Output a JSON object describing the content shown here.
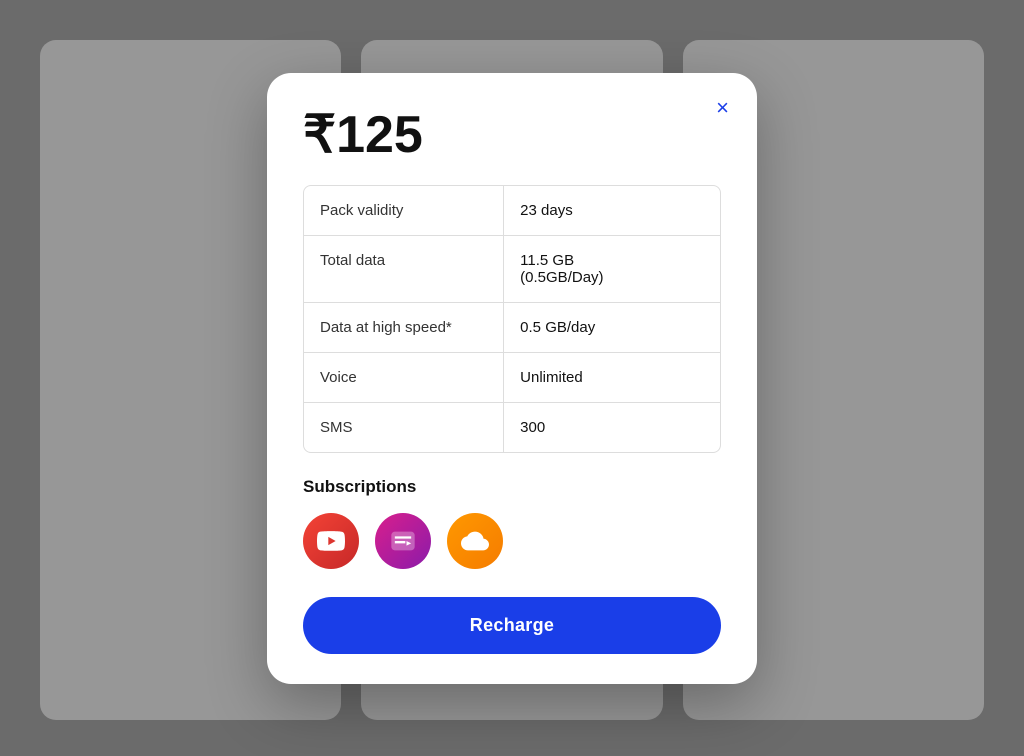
{
  "modal": {
    "price": "₹125",
    "close_label": "×",
    "table": {
      "rows": [
        {
          "label": "Pack validity",
          "value": "23 days"
        },
        {
          "label": "Total data",
          "value": "11.5 GB\n(0.5GB/Day)"
        },
        {
          "label": "Data at high speed*",
          "value": "0.5 GB/day"
        },
        {
          "label": "Voice",
          "value": "Unlimited"
        },
        {
          "label": "SMS",
          "value": "300"
        }
      ]
    },
    "subscriptions": {
      "title": "Subscriptions",
      "icons": [
        {
          "name": "youtube",
          "label": "YouTube"
        },
        {
          "name": "hotstar",
          "label": "Hotstar"
        },
        {
          "name": "cloud",
          "label": "Cloud"
        }
      ]
    },
    "recharge_button_label": "Recharge"
  },
  "colors": {
    "accent": "#1a3ee8",
    "close": "#1a3ee8"
  }
}
